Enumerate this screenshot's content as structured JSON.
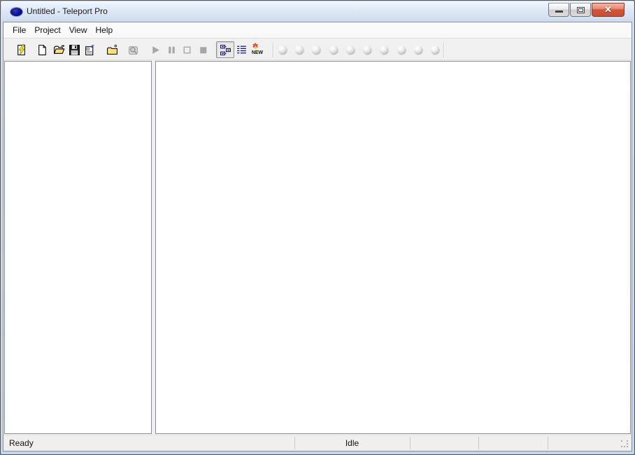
{
  "window": {
    "title": "Untitled - Teleport Pro",
    "app_icon": "teleport-blue-oval-icon",
    "controls": [
      {
        "name": "minimize-button"
      },
      {
        "name": "maximize-button"
      },
      {
        "name": "close-button"
      }
    ]
  },
  "menu": {
    "items": [
      {
        "label": "File"
      },
      {
        "label": "Project"
      },
      {
        "label": "View"
      },
      {
        "label": "Help"
      }
    ]
  },
  "toolbar": {
    "icons": [
      {
        "name": "new-project-wizard-icon",
        "shape": "page-with-yellow-lightning",
        "state": "enabled"
      },
      {
        "name": "new-project-icon",
        "shape": "blank-page",
        "state": "enabled"
      },
      {
        "name": "open-project-icon",
        "shape": "yellow-open-folder",
        "state": "enabled"
      },
      {
        "name": "save-project-icon",
        "shape": "floppy-disk",
        "state": "enabled"
      },
      {
        "name": "project-properties-icon",
        "shape": "form-with-blue-arrow",
        "state": "enabled"
      },
      {
        "name": "new-address-icon",
        "shape": "yellow-folder-sparkle",
        "state": "enabled"
      },
      {
        "name": "search-icon",
        "shape": "grayed-binoculars",
        "state": "disabled"
      },
      {
        "name": "start-icon",
        "shape": "play-triangle",
        "state": "disabled"
      },
      {
        "name": "pause-icon",
        "shape": "pause-bars",
        "state": "disabled"
      },
      {
        "name": "stop-icon",
        "shape": "hollow-square",
        "state": "disabled"
      },
      {
        "name": "abort-icon",
        "shape": "filled-square",
        "state": "disabled"
      },
      {
        "name": "tree-view-icon",
        "shape": "navy-outline-boxes",
        "state": "active-pressed"
      },
      {
        "name": "detail-view-icon",
        "shape": "navy-table-lines",
        "state": "enabled"
      },
      {
        "name": "new-files-view-icon",
        "shape": "new-text-with-red-sparkle",
        "state": "enabled"
      }
    ],
    "new_view_label": "NEW",
    "new_view_star": "✲",
    "thread_indicator_count": 10
  },
  "statusbar": {
    "status": "Ready",
    "mode": "Idle",
    "empty_pane_count": 3
  },
  "colors": {
    "frame_blue": "#c2d6ee",
    "close_red": "#c94f34",
    "icon_navy": "#000080",
    "folder_yellow": "#ffe27f",
    "toolbar_gray": "#f0f0f0"
  }
}
